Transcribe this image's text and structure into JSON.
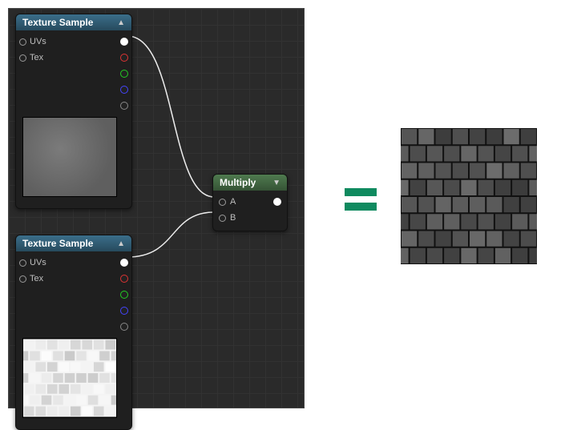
{
  "nodes": {
    "texA": {
      "title": "Texture Sample",
      "inputs": [
        "UVs",
        "Tex"
      ],
      "outputs": [
        "rgb",
        "r",
        "g",
        "b",
        "a"
      ]
    },
    "texB": {
      "title": "Texture Sample",
      "inputs": [
        "UVs",
        "Tex"
      ],
      "outputs": [
        "rgb",
        "r",
        "g",
        "b",
        "a"
      ]
    },
    "multiply": {
      "title": "Multiply",
      "inputs": [
        "A",
        "B"
      ],
      "outputs": [
        "out"
      ]
    }
  },
  "symbol": "=",
  "colors": {
    "equals": "#0f8a5f",
    "header_tex": "#3b6e8a",
    "header_mult": "#4f7a4f"
  }
}
